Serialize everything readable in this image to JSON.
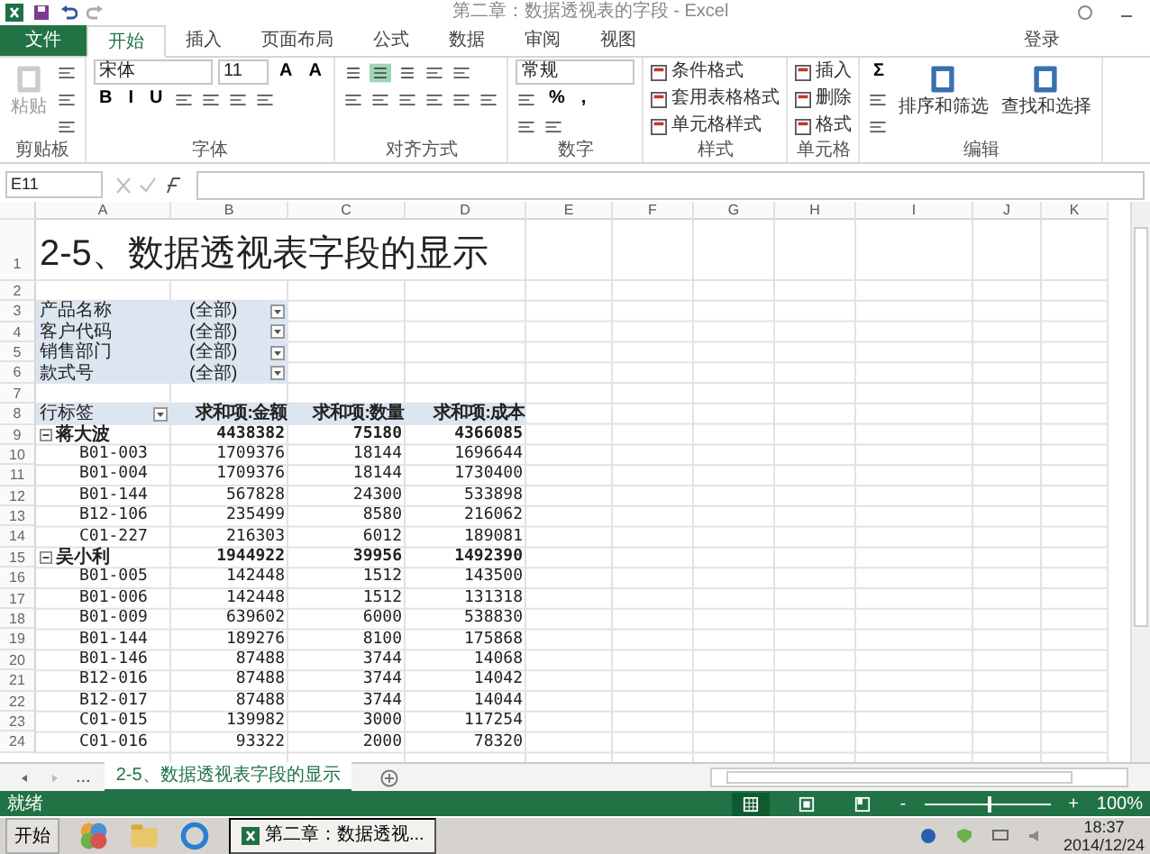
{
  "window": {
    "title": "第二章：数据透视表的字段 - Excel",
    "sign_in": "登录"
  },
  "ribbon_tabs": [
    {
      "label": "文件",
      "kind": "file",
      "selected": false
    },
    {
      "label": "开始",
      "kind": "tab",
      "selected": true
    },
    {
      "label": "插入",
      "kind": "tab",
      "selected": false
    },
    {
      "label": "页面布局",
      "kind": "tab",
      "selected": false
    },
    {
      "label": "公式",
      "kind": "tab",
      "selected": false
    },
    {
      "label": "数据",
      "kind": "tab",
      "selected": false
    },
    {
      "label": "审阅",
      "kind": "tab",
      "selected": false
    },
    {
      "label": "视图",
      "kind": "tab",
      "selected": false
    }
  ],
  "ribbon_groups": [
    {
      "label": "剪贴板",
      "items": [
        {
          "kind": "large",
          "label": "粘贴",
          "disabled": true
        },
        {
          "kind": "stack",
          "lines": [
            {
              "tools": [
                {
                  "kind": "icon"
                }
              ]
            },
            {
              "tools": [
                {
                  "kind": "icon"
                }
              ]
            },
            {
              "tools": [
                {
                  "kind": "icon"
                }
              ]
            }
          ]
        }
      ]
    },
    {
      "label": "字体",
      "items": [
        {
          "kind": "stack",
          "lines": [
            {
              "tools": [
                {
                  "kind": "combo",
                  "value": "宋体"
                },
                {
                  "kind": "combo-small",
                  "value": "11"
                },
                {
                  "kind": "glyph",
                  "text": "A"
                },
                {
                  "kind": "glyph",
                  "text": "A"
                }
              ]
            },
            {
              "tools": [
                {
                  "kind": "glyph",
                  "text": "B"
                },
                {
                  "kind": "glyph",
                  "text": "I"
                },
                {
                  "kind": "glyph",
                  "text": "U"
                },
                {
                  "kind": "icon"
                },
                {
                  "kind": "icon"
                },
                {
                  "kind": "icon"
                },
                {
                  "kind": "icon"
                }
              ]
            }
          ]
        }
      ]
    },
    {
      "label": "对齐方式",
      "items": [
        {
          "kind": "stack",
          "lines": [
            {
              "tools": [
                {
                  "kind": "toggle",
                  "selected": false
                },
                {
                  "kind": "toggle",
                  "selected": true
                },
                {
                  "kind": "toggle",
                  "selected": false
                },
                {
                  "kind": "icon"
                },
                {
                  "kind": "icon"
                }
              ]
            },
            {
              "tools": [
                {
                  "kind": "icon"
                },
                {
                  "kind": "icon"
                },
                {
                  "kind": "icon"
                },
                {
                  "kind": "icon"
                },
                {
                  "kind": "icon"
                },
                {
                  "kind": "icon"
                }
              ]
            }
          ]
        }
      ]
    },
    {
      "label": "数字",
      "items": [
        {
          "kind": "stack",
          "lines": [
            {
              "tools": [
                {
                  "kind": "combo",
                  "value": "常规"
                }
              ]
            },
            {
              "tools": [
                {
                  "kind": "icon"
                },
                {
                  "kind": "glyph",
                  "text": "%"
                },
                {
                  "kind": "glyph",
                  "text": ","
                }
              ]
            },
            {
              "tools": [
                {
                  "kind": "icon"
                },
                {
                  "kind": "icon"
                }
              ]
            }
          ]
        }
      ]
    },
    {
      "label": "样式",
      "items": [
        {
          "kind": "stack",
          "lines": [
            {
              "tools": [
                {
                  "kind": "small",
                  "label": "条件格式"
                }
              ]
            },
            {
              "tools": [
                {
                  "kind": "small",
                  "label": "套用表格格式"
                }
              ]
            },
            {
              "tools": [
                {
                  "kind": "small",
                  "label": "单元格样式"
                }
              ]
            }
          ]
        }
      ]
    },
    {
      "label": "单元格",
      "items": [
        {
          "kind": "stack",
          "lines": [
            {
              "tools": [
                {
                  "kind": "small",
                  "label": "插入"
                }
              ]
            },
            {
              "tools": [
                {
                  "kind": "small",
                  "label": "删除"
                }
              ]
            },
            {
              "tools": [
                {
                  "kind": "small",
                  "label": "格式"
                }
              ]
            }
          ]
        }
      ]
    },
    {
      "label": "编辑",
      "items": [
        {
          "kind": "stack",
          "lines": [
            {
              "tools": [
                {
                  "kind": "glyph",
                  "text": "Σ"
                }
              ]
            },
            {
              "tools": [
                {
                  "kind": "icon"
                }
              ]
            },
            {
              "tools": [
                {
                  "kind": "icon"
                }
              ]
            }
          ]
        },
        {
          "kind": "large",
          "label": "排序和筛选",
          "disabled": false
        },
        {
          "kind": "large",
          "label": "查找和选择",
          "disabled": false
        }
      ]
    }
  ],
  "name_box": "E11",
  "columns": [
    "A",
    "B",
    "C",
    "D",
    "E",
    "F",
    "G",
    "H",
    "I",
    "J",
    "K"
  ],
  "rows": [
    {
      "number": "1",
      "kind": "title",
      "text": "2-5、数据透视表字段的显示"
    },
    {
      "number": "2",
      "kind": "blank"
    },
    {
      "number": "3",
      "kind": "filter",
      "label": "产品名称",
      "value": "(全部)"
    },
    {
      "number": "4",
      "kind": "filter",
      "label": "客户代码",
      "value": "(全部)"
    },
    {
      "number": "5",
      "kind": "filter",
      "label": "销售部门",
      "value": "(全部)"
    },
    {
      "number": "6",
      "kind": "filter",
      "label": "款式号",
      "value": "(全部)"
    },
    {
      "number": "7",
      "kind": "blank"
    },
    {
      "number": "8",
      "kind": "header",
      "cells": [
        "行标签",
        "求和项:金额",
        "求和项:数量",
        "求和项:成本"
      ]
    },
    {
      "number": "9",
      "kind": "group",
      "expanded": true,
      "cells": [
        "蒋大波",
        "4438382",
        "75180",
        "4366085"
      ]
    },
    {
      "number": "10",
      "kind": "item",
      "cells": [
        "B01-003",
        "1709376",
        "18144",
        "1696644"
      ]
    },
    {
      "number": "11",
      "kind": "item",
      "cells": [
        "B01-004",
        "1709376",
        "18144",
        "1730400"
      ]
    },
    {
      "number": "12",
      "kind": "item",
      "cells": [
        "B01-144",
        "567828",
        "24300",
        "533898"
      ]
    },
    {
      "number": "13",
      "kind": "item",
      "cells": [
        "B12-106",
        "235499",
        "8580",
        "216062"
      ]
    },
    {
      "number": "14",
      "kind": "item",
      "cells": [
        "C01-227",
        "216303",
        "6012",
        "189081"
      ]
    },
    {
      "number": "15",
      "kind": "group",
      "expanded": true,
      "cells": [
        "吴小利",
        "1944922",
        "39956",
        "1492390"
      ]
    },
    {
      "number": "16",
      "kind": "item",
      "cells": [
        "B01-005",
        "142448",
        "1512",
        "143500"
      ]
    },
    {
      "number": "17",
      "kind": "item",
      "cells": [
        "B01-006",
        "142448",
        "1512",
        "131318"
      ]
    },
    {
      "number": "18",
      "kind": "item",
      "cells": [
        "B01-009",
        "639602",
        "6000",
        "538830"
      ]
    },
    {
      "number": "19",
      "kind": "item",
      "cells": [
        "B01-144",
        "189276",
        "8100",
        "175868"
      ]
    },
    {
      "number": "20",
      "kind": "item",
      "cells": [
        "B01-146",
        "87488",
        "3744",
        "14068"
      ]
    },
    {
      "number": "21",
      "kind": "item",
      "cells": [
        "B12-016",
        "87488",
        "3744",
        "14042"
      ]
    },
    {
      "number": "22",
      "kind": "item",
      "cells": [
        "B12-017",
        "87488",
        "3744",
        "14044"
      ]
    },
    {
      "number": "23",
      "kind": "item",
      "cells": [
        "C01-015",
        "139982",
        "3000",
        "117254"
      ]
    },
    {
      "number": "24",
      "kind": "item",
      "cells": [
        "C01-016",
        "93322",
        "2000",
        "78320"
      ]
    }
  ],
  "sheet_tabs": {
    "more": "...",
    "tabs": [
      {
        "label": "2-5、数据透视表字段的显示",
        "selected": true
      }
    ]
  },
  "status_bar": {
    "text": "就绪",
    "views": [
      {
        "selected": true
      },
      {
        "selected": false
      },
      {
        "selected": false
      }
    ],
    "zoom_minus": "-",
    "zoom_plus": "+",
    "zoom": {
      "level": 0.5
    },
    "zoom_text": "100%"
  },
  "taskbar": {
    "start": "开始",
    "windows": [
      {
        "label": "第二章：数据透视...",
        "selected": true
      }
    ],
    "time": "18:37",
    "date": "2014/12/24"
  }
}
